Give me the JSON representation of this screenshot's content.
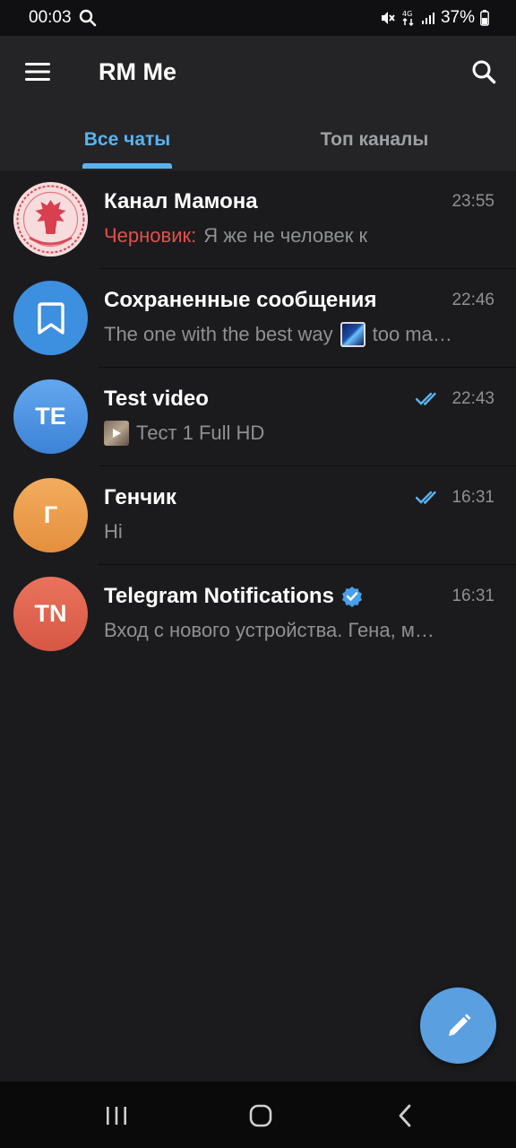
{
  "status_bar": {
    "time": "00:03",
    "battery": "37%",
    "icons": [
      "search-icon",
      "mute-icon",
      "network-4g-icon",
      "signal-icon",
      "battery-icon"
    ]
  },
  "header": {
    "title": "RM Me",
    "menu_icon": "hamburger-menu-icon",
    "search_icon": "search-icon"
  },
  "tabs": [
    {
      "label": "Все чаты",
      "active": true
    },
    {
      "label": "Топ каналы",
      "active": false
    }
  ],
  "colors": {
    "accent": "#5ab3f0",
    "draft": "#e2504d",
    "fab": "#5a9fe0",
    "background": "#1b1b1d",
    "header": "#242426"
  },
  "chats": [
    {
      "name": "Канал Мамона",
      "time": "23:55",
      "draft_label": "Черновик:",
      "preview": "Я же не человек к",
      "avatar": "image",
      "avatar_icon": "emblem-seal-avatar"
    },
    {
      "name": "Сохраненные сообщения",
      "time": "22:46",
      "preview_part1": "The one with the best way",
      "preview_part2": "too ma…",
      "avatar_icon": "bookmark-icon",
      "avatar_color": "#3d8fe0"
    },
    {
      "name": "Test video",
      "time": "22:43",
      "read_icon": "double-check-icon",
      "preview": "Тест 1 Full HD",
      "avatar_text": "TE",
      "avatar_color": "#4f94e0"
    },
    {
      "name": "Генчик",
      "time": "16:31",
      "read_icon": "double-check-icon",
      "preview": "Hi",
      "avatar_text": "Г",
      "avatar_color": "#eb9a48"
    },
    {
      "name": "Telegram Notifications",
      "time": "16:31",
      "verified_icon": "verified-badge-icon",
      "preview": "Вход с нового устройства. Гена, м…",
      "avatar_text": "TN",
      "avatar_color": "#e06450"
    }
  ],
  "fab": {
    "icon": "pencil-icon"
  },
  "nav_bar": {
    "icons": [
      "recent-apps-icon",
      "home-icon",
      "back-icon"
    ]
  }
}
